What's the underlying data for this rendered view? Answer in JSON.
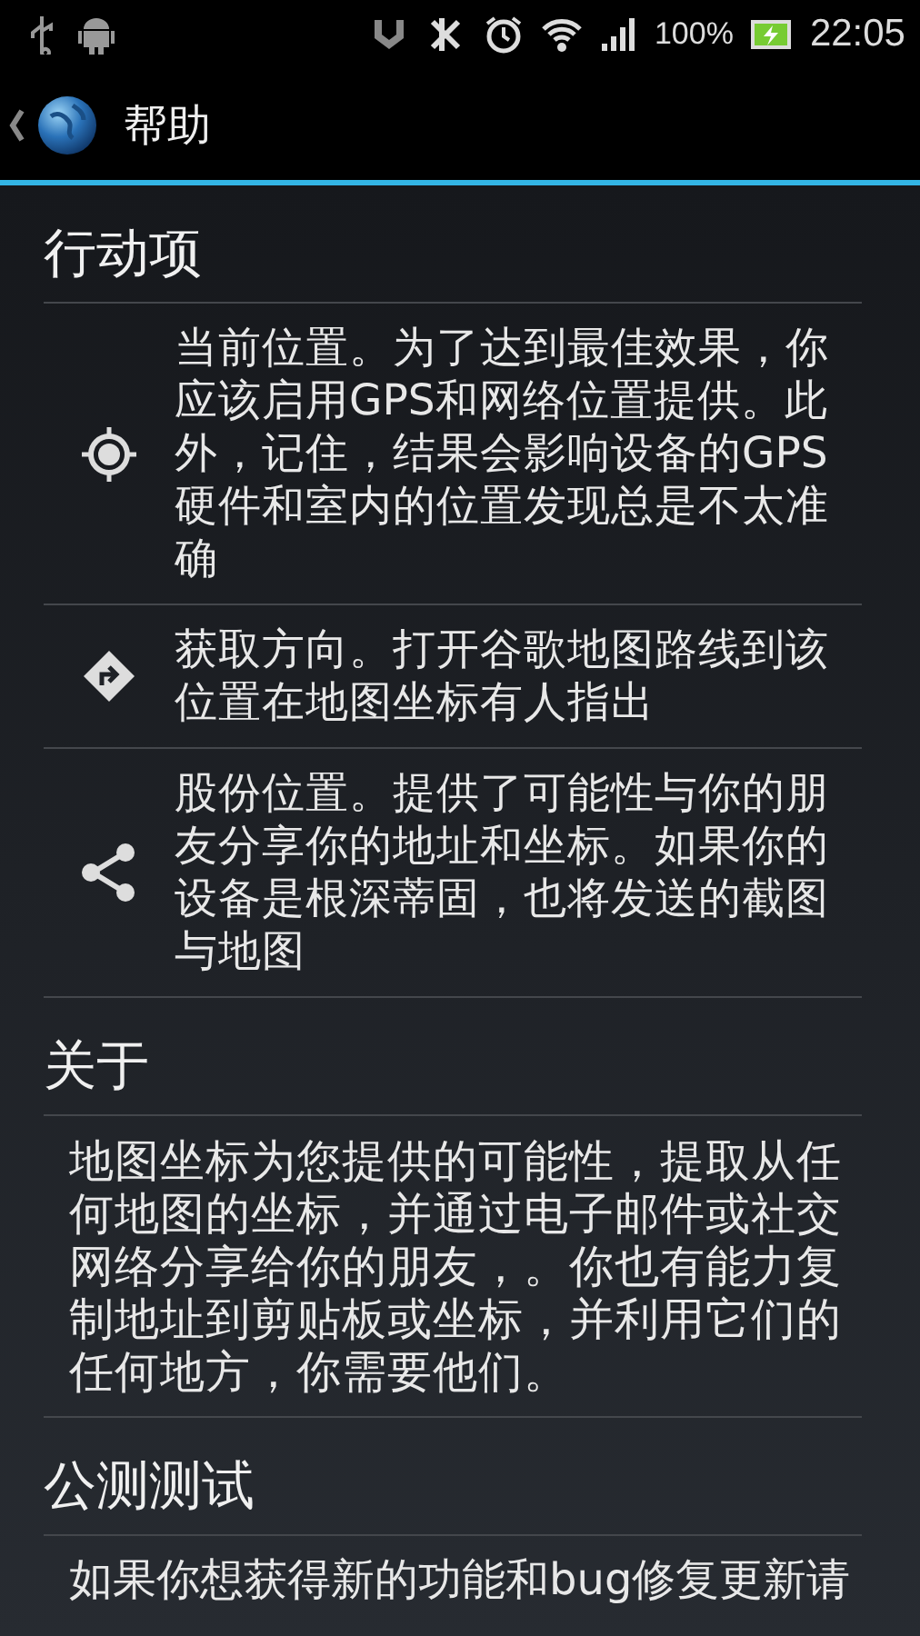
{
  "status_bar": {
    "battery": "100%",
    "time": "22:05"
  },
  "action_bar": {
    "title": "帮助"
  },
  "sections": [
    {
      "title": "行动项",
      "items": [
        {
          "kind": "locate",
          "text": "当前位置。为了达到最佳效果，你应该启用GPS和网络位置提供。此外，记住，结果会影响设备的GPS硬件和室内的位置发现总是不太准确"
        },
        {
          "kind": "directions",
          "text": "获取方向。打开谷歌地图路线到该位置在地图坐标有人指出"
        },
        {
          "kind": "share",
          "text": "股份位置。提供了可能性与你的朋友分享你的地址和坐标。如果你的设备是根深蒂固，也将发送的截图与地图"
        }
      ]
    },
    {
      "title": "关于",
      "paragraph": "地图坐标为您提供的可能性，提取从任何地图的坐标，并通过电子邮件或社交网络分享给你的朋友，。你也有能力复制地址到剪贴板或坐标，并利用它们的任何地方，你需要他们。"
    },
    {
      "title": "公测测试",
      "paragraph": "如果你想获得新的功能和bug修复更新请"
    }
  ]
}
